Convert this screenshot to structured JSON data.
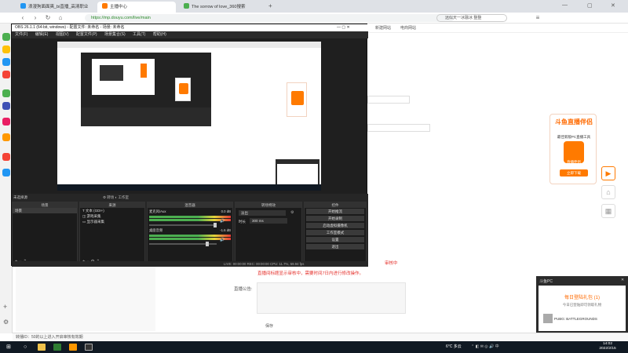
{
  "browser": {
    "tabs": [
      {
        "label": "浪漫狗面面爽_bi直播_高清职业"
      },
      {
        "label": "主播中心"
      },
      {
        "label": "The sorrow of love_360搜索"
      }
    ],
    "url": "https://mp.douyu.com/live/main",
    "search_placeholder": "远似天一冰融冰 整整",
    "bookmarks": [
      "新建网站",
      "电商网站"
    ]
  },
  "obs": {
    "title": "OBS 26.1.1 (64-bit, windows) - 配置文件: 未命名 - 场景: 未命名",
    "menu": [
      "文件(F)",
      "编辑(E)",
      "视图(V)",
      "配置文件(P)",
      "场景集合(S)",
      "工具(T)",
      "帮助(H)"
    ],
    "scene_toggle": [
      "转场",
      "工作室"
    ],
    "no_source_label": "未选择源",
    "panels": {
      "scenes": {
        "header": "场景",
        "items": [
          "场景"
        ]
      },
      "sources": {
        "header": "来源",
        "items": [
          "文本 (GDI+)",
          "游戏采集",
          "显示器采集"
        ]
      },
      "mixer": {
        "header": "混音器",
        "channels": [
          {
            "name": "麦克风/Aux",
            "value": "0.0 dB"
          },
          {
            "name": "桌面音频",
            "value": "-1.6 dB"
          }
        ]
      },
      "transitions": {
        "header": "转场特效",
        "type": "淡出",
        "duration_label": "时长",
        "duration": "300 ms"
      },
      "controls": {
        "header": "控件",
        "buttons": [
          "开始推流",
          "开始录制",
          "启动虚拟摄像机",
          "工作室模式",
          "设置",
          "退出"
        ]
      }
    },
    "status": "LIVE: 00:00:00   REC: 00:00:00   CPU: 11.7%, 59.94 fps"
  },
  "page": {
    "douyu_banner": {
      "title": "斗鱼直播伴侣",
      "subtitle": "最佳新版PC直播工具",
      "logo_text": "直播伴侣",
      "button": "立即下载"
    },
    "notice_line1": "审核中",
    "notice_line2": "直播间标题显示审核中，需要时间7日内进行修改操作。",
    "announce_label": "直播公告:",
    "save_label": "保存",
    "bottom_status": "转播ID：50的以上进入开启审核有效期"
  },
  "toast": {
    "app": "斗鱼PC",
    "title": "每日登陆礼包 (1)",
    "subtitle": "今日已登陆即可领取礼物",
    "source": "PUBG: BATTLEGROUNDS"
  },
  "taskbar": {
    "weather": "6°C 多云",
    "time": "14:02",
    "date": "2022/2/15"
  },
  "colors": {
    "accent": "#ff7a00",
    "obs_bg": "#1f1f1f",
    "taskbar": "#101923"
  }
}
